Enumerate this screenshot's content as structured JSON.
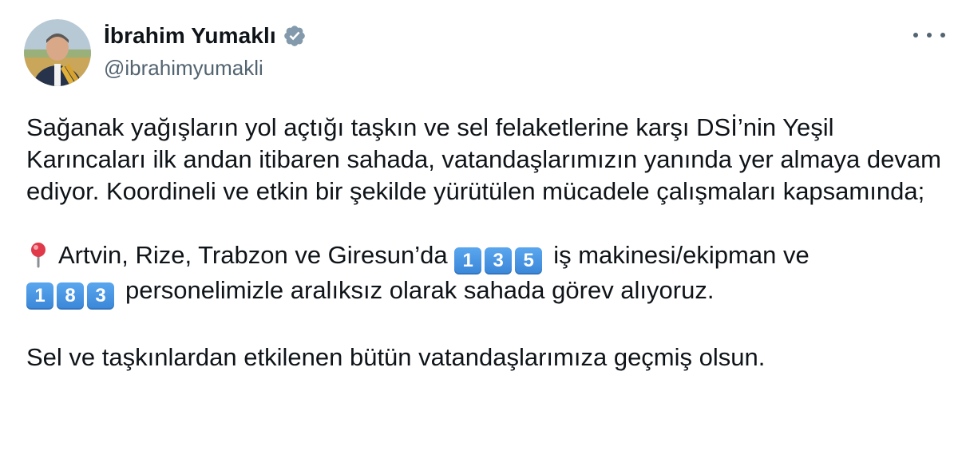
{
  "author": {
    "display_name": "İbrahim Yumaklı",
    "handle": "@ibrahimyumakli",
    "verified": true
  },
  "icons": {
    "verified": "verified-badge-icon",
    "more": "more-options-icon",
    "pin": "round-pushpin-icon",
    "keycap": "keycap-digit-icon"
  },
  "colors": {
    "text": "#0f1419",
    "secondary_text": "#536471",
    "keycap_blue": "#3b8ad9",
    "verified_badge": "#829aab"
  },
  "tweet": {
    "paragraph_1": "Sağanak yağışların yol açtığı taşkın ve sel felaketlerine karşı DSİ’nin Yeşil Karıncaları ilk andan itibaren sahada, vatandaşlarımızın yanında yer almaya devam ediyor. Koordineli ve etkin bir şekilde yürütülen mücadele çalışmaları kapsamında;",
    "paragraph_2_part_1": "Artvin, Rize, Trabzon ve Giresun’da",
    "machines_count_digits": [
      "1",
      "3",
      "5"
    ],
    "paragraph_2_part_2": "iş makinesi/ekipman ve",
    "personnel_count_digits": [
      "1",
      "8",
      "3"
    ],
    "paragraph_2_part_3": "personelimizle aralıksız olarak sahada görev alıyoruz.",
    "paragraph_3": "Sel ve taşkınlardan etkilenen bütün vatandaşlarımıza geçmiş olsun."
  }
}
